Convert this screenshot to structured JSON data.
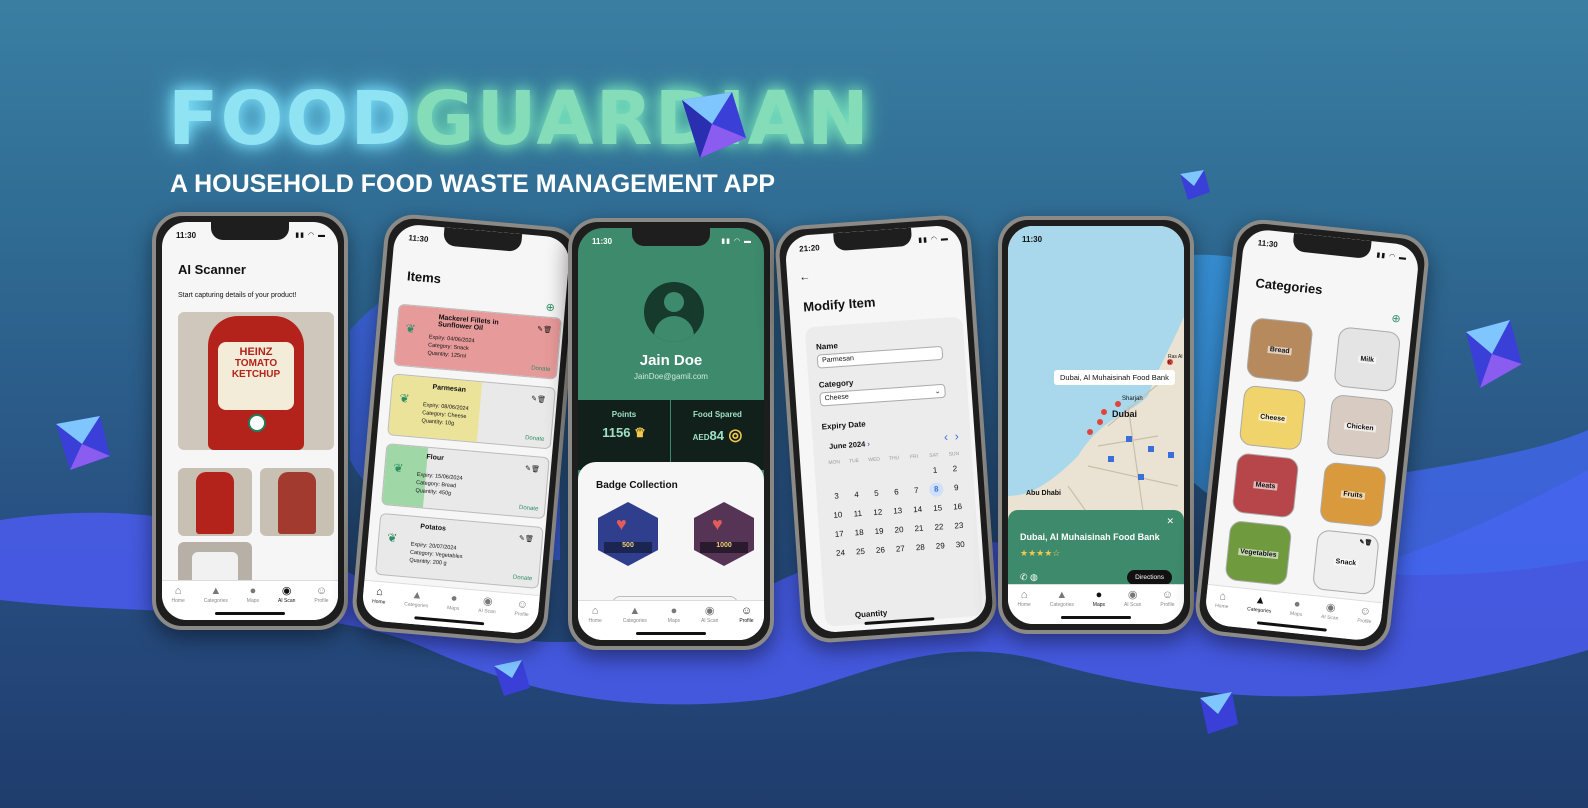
{
  "brand": {
    "part1": "FOOD",
    "part2": "GUARDIAN",
    "tagline": "A HOUSEHOLD FOOD WASTE MANAGEMENT APP"
  },
  "nav": {
    "tabs": [
      "Home",
      "Categories",
      "Maps",
      "AI Scan",
      "Profile"
    ]
  },
  "scanner": {
    "time": "11:30",
    "title": "AI Scanner",
    "subtitle": "Start capturing details of your product!",
    "product_lines": [
      "HEINZ",
      "TOMATO",
      "KETCHUP"
    ]
  },
  "items": {
    "time": "11:30",
    "title": "Items",
    "list": [
      {
        "name": "Mackerel Fillets in Sunflower Oil",
        "expiry": "Expiry: 04/06/2024",
        "category": "Category: Snack",
        "quantity": "Quantity: 125ml",
        "color": "#e79a9a"
      },
      {
        "name": "Parmesan",
        "expiry": "Expiry: 08/06/2024",
        "category": "Category: Cheese",
        "quantity": "Quantity: 10g",
        "color": "#ece39a"
      },
      {
        "name": "Flour",
        "expiry": "Expiry: 15/06/2024",
        "category": "Category: Bread",
        "quantity": "Quantity: 450g",
        "color": "#9fd8a6"
      },
      {
        "name": "Potatos",
        "expiry": "Expiry: 20/07/2024",
        "category": "Category: Vegetables",
        "quantity": "Quantity: 200 g",
        "color": "#d5d5d5"
      }
    ],
    "donate": "Donate"
  },
  "profile": {
    "time": "11:30",
    "name": "Jain Doe",
    "email": "JainDoe@gamil.com",
    "points_label": "Points",
    "points_value": "1156",
    "spared_label": "Food Spared",
    "spared_prefix": "AED",
    "spared_value": "84",
    "badges_title": "Badge Collection",
    "badge1": "500",
    "badge2": "1000"
  },
  "modify": {
    "time": "21:20",
    "title": "Modify Item",
    "name_label": "Name",
    "name_value": "Parmesan",
    "category_label": "Category",
    "category_value": "Cheese",
    "expiry_label": "Expiry Date",
    "month": "June 2024",
    "weekdays": [
      "MON",
      "TUE",
      "WED",
      "THU",
      "FRI",
      "SAT",
      "SUN"
    ],
    "days": [
      "",
      "",
      "",
      "",
      "",
      "1",
      "2",
      "3",
      "4",
      "5",
      "6",
      "7",
      "8",
      "9",
      "10",
      "11",
      "12",
      "13",
      "14",
      "15",
      "16",
      "17",
      "18",
      "19",
      "20",
      "21",
      "22",
      "23",
      "24",
      "25",
      "26",
      "27",
      "28",
      "29",
      "30"
    ],
    "selected": "8",
    "quantity_label": "Quantity"
  },
  "map": {
    "time": "11:30",
    "popup": "Dubai, Al Muhaisinah Food Bank",
    "city1": "Dubai",
    "city2": "Abu Dhabi",
    "city3": "Sharjah",
    "city4": "Ras Al K",
    "place_title": "Dubai, Al Muhaisinah Food Bank",
    "stars": "★★★★☆",
    "directions": "Directions"
  },
  "categories": {
    "time": "11:30",
    "title": "Categories",
    "list": [
      {
        "label": "Bread",
        "color": "#b78a5e"
      },
      {
        "label": "Milk",
        "color": "#e4e4e4"
      },
      {
        "label": "Cheese",
        "color": "#f0d36a"
      },
      {
        "label": "Chicken",
        "color": "#d8ccc2"
      },
      {
        "label": "Meats",
        "color": "#b6464a"
      },
      {
        "label": "Fruits",
        "color": "#d99a3e"
      },
      {
        "label": "Vegetables",
        "color": "#6f9b3e"
      },
      {
        "label": "Snack",
        "color": "#efefef"
      }
    ]
  }
}
